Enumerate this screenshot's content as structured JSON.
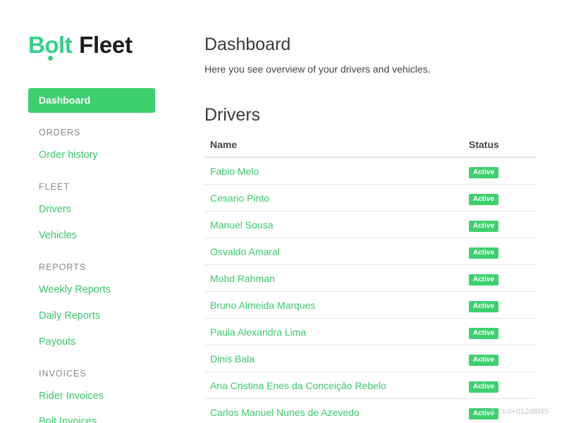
{
  "brand": {
    "name": "Bolt",
    "product": "Fleet",
    "brand_color": "#34d186",
    "accent_color": "#3ed06e"
  },
  "sidebar": {
    "active_item": "Dashboard",
    "sections": [
      {
        "title": "ORDERS",
        "items": [
          "Order history"
        ]
      },
      {
        "title": "FLEET",
        "items": [
          "Drivers",
          "Vehicles"
        ]
      },
      {
        "title": "REPORTS",
        "items": [
          "Weekly Reports",
          "Daily Reports",
          "Payouts"
        ]
      },
      {
        "title": "INVOICES",
        "items": [
          "Rider Invoices",
          "Bolt Invoices"
        ]
      }
    ]
  },
  "main": {
    "title": "Dashboard",
    "subtitle": "Here you see overview of your drivers and vehicles.",
    "drivers_section": {
      "title": "Drivers",
      "columns": [
        "Name",
        "Status"
      ],
      "rows": [
        {
          "name": "Fabio Melo",
          "status": "Active"
        },
        {
          "name": "Cesario Pinto",
          "status": "Active"
        },
        {
          "name": "Manuel Sousa",
          "status": "Active"
        },
        {
          "name": "Osvaldo Amaral",
          "status": "Active"
        },
        {
          "name": "Mohd Rahman",
          "status": "Active"
        },
        {
          "name": "Bruno Almeida Marques",
          "status": "Active"
        },
        {
          "name": "Paula Alexandra Lima",
          "status": "Active"
        },
        {
          "name": "Dinis Bala",
          "status": "Active"
        },
        {
          "name": "Ana Cristina Enes da Conceição Rebelo",
          "status": "Active"
        },
        {
          "name": "Carlos Manuel Nunes de Azevedo",
          "status": "Active"
        }
      ]
    }
  },
  "footer": {
    "version": "2.13.0+012d8f45"
  }
}
